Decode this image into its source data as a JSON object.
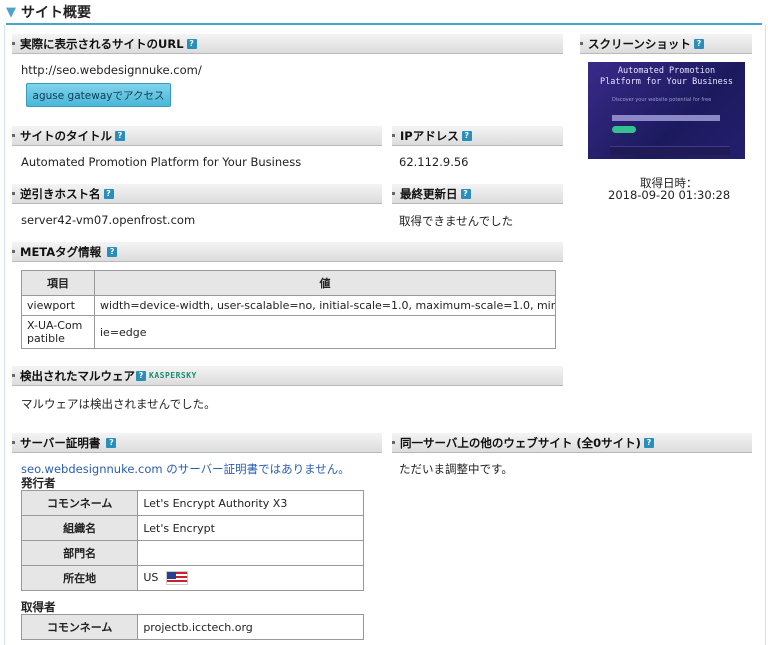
{
  "page": {
    "title": "サイト概要"
  },
  "url_section": {
    "header": "実際に表示されるサイトのURL",
    "url": "http://seo.webdesignnuke.com/",
    "button": "aguse gatewayでアクセス"
  },
  "screenshot": {
    "header": "スクリーンショット",
    "thumb_line1": "Automated Promotion",
    "thumb_line2": "Platform for Your Business",
    "thumb_line3": "Discover your website potential for free",
    "taken_label": "取得日時：",
    "taken_value": "2018-09-20 01:30:28"
  },
  "site_title": {
    "header": "サイトのタイトル",
    "value": "Automated Promotion Platform for Your Business"
  },
  "ip": {
    "header": "IPアドレス",
    "value": "62.112.9.56"
  },
  "reverse_host": {
    "header": "逆引きホスト名",
    "value": "server42-vm07.openfrost.com"
  },
  "last_updated": {
    "header": "最終更新日",
    "value": "取得できませんでした"
  },
  "meta": {
    "header": "METAタグ情報",
    "columns": [
      "項目",
      "値"
    ],
    "rows": [
      {
        "key": "viewport",
        "value": "width=device-width, user-scalable=no, initial-scale=1.0, maximum-scale=1.0, minim…"
      },
      {
        "key": "X-UA-Compatible",
        "value": "ie=edge"
      }
    ]
  },
  "malware": {
    "header": "検出されたマルウェア",
    "logo": "KASPERSKY",
    "result": "マルウェアは検出されませんでした。"
  },
  "cert": {
    "header": "サーバー証明書",
    "notice": "seo.webdesignnuke.com のサーバー証明書ではありません。",
    "issuer_label": "発行者",
    "issuer_rows": [
      {
        "k": "コモンネーム",
        "v": "Let's Encrypt Authority X3"
      },
      {
        "k": "組織名",
        "v": "Let's Encrypt"
      },
      {
        "k": "部門名",
        "v": ""
      },
      {
        "k": "所在地",
        "v": "US"
      }
    ],
    "subject_label": "取得者",
    "subject_rows": [
      {
        "k": "コモンネーム",
        "v": "projectb.icctech.org"
      }
    ]
  },
  "same_server": {
    "header": "同一サーバ上の他のウェブサイト (全0サイト)",
    "value": "ただいま調整中です。"
  }
}
